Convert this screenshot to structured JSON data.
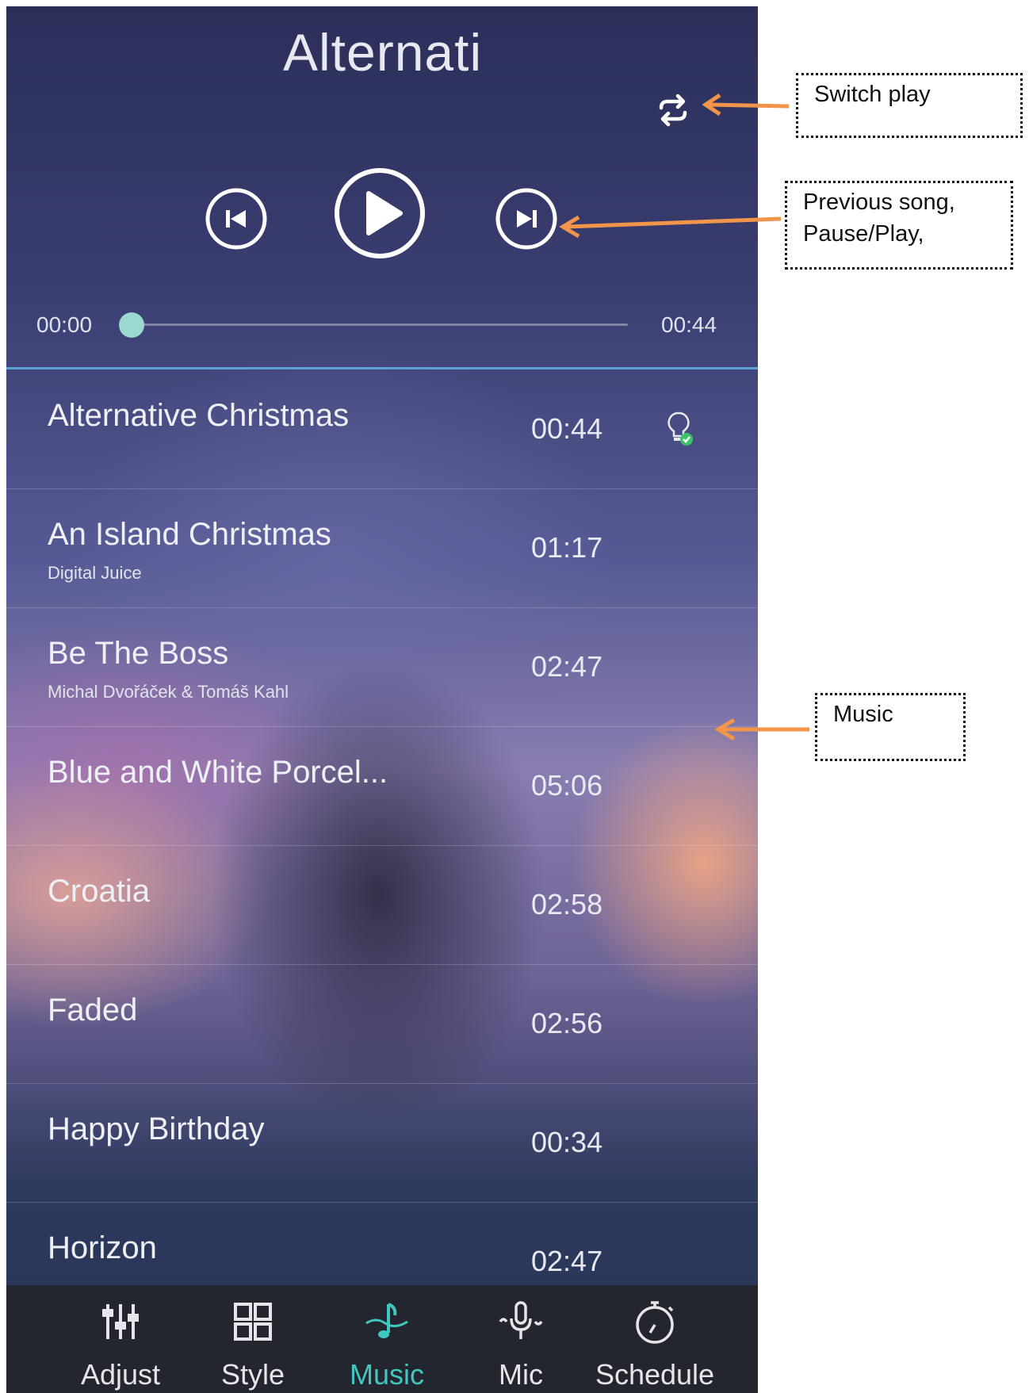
{
  "player": {
    "title": "Alternati",
    "current_time": "00:00",
    "duration": "00:44",
    "progress": 0.0
  },
  "songs": [
    {
      "name": "Alternative Christmas",
      "artist": "",
      "duration": "00:44",
      "icon": "bulb-check-icon"
    },
    {
      "name": "An Island Christmas",
      "artist": "Digital Juice",
      "duration": "01:17"
    },
    {
      "name": "Be The Boss",
      "artist": "Michal Dvořáček & Tomáš Kahl",
      "duration": "02:47"
    },
    {
      "name": "Blue and White Porcel...",
      "artist": "",
      "duration": "05:06"
    },
    {
      "name": "Croatia",
      "artist": "",
      "duration": "02:58"
    },
    {
      "name": "Faded",
      "artist": "",
      "duration": "02:56"
    },
    {
      "name": "Happy Birthday",
      "artist": "",
      "duration": "00:34"
    },
    {
      "name": "Horizon",
      "artist": "",
      "duration": "02:47"
    }
  ],
  "nav": {
    "items": [
      {
        "label": "Adjust",
        "icon": "sliders-icon"
      },
      {
        "label": "Style",
        "icon": "grid-icon"
      },
      {
        "label": "Music",
        "icon": "music-note-icon",
        "active": true
      },
      {
        "label": "Mic",
        "icon": "microphone-icon"
      },
      {
        "label": "Schedule",
        "icon": "timer-icon"
      }
    ]
  },
  "callouts": {
    "switch_play": "Switch play",
    "controls_line1": "Previous song,",
    "controls_line2": "Pause/Play,",
    "music": "Music"
  },
  "colors": {
    "accent": "#3fc7c0",
    "arrow": "#f0954a",
    "divider": "#5aa3d8"
  }
}
